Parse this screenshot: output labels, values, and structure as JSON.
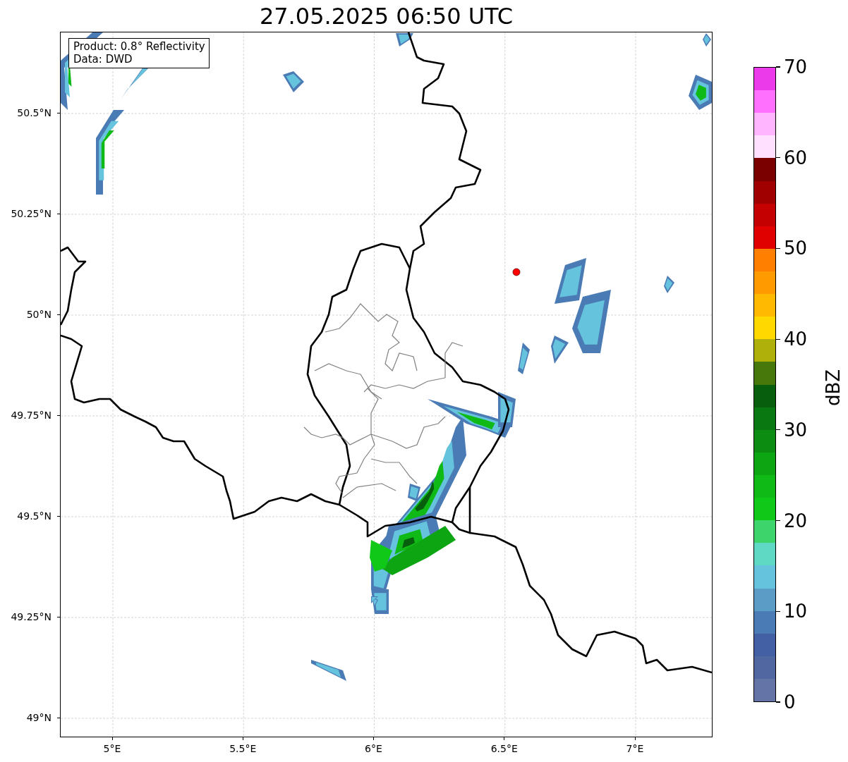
{
  "title": "27.05.2025 06:50 UTC",
  "legend": [
    "Product: 0.8° Reflectivity",
    "Data: DWD"
  ],
  "map": {
    "xticks": [
      "5°E",
      "5.5°E",
      "6°E",
      "6.5°E",
      "7°E"
    ],
    "yticks": [
      "50.5°N",
      "50.25°N",
      "50°N",
      "49.75°N",
      "49.5°N",
      "49.25°N",
      "49°N"
    ]
  },
  "colorbar": {
    "label": "dBZ",
    "ticks": [
      "70",
      "60",
      "50",
      "40",
      "30",
      "20",
      "10",
      "0"
    ],
    "bins": [
      {
        "color": "#ea3aea"
      },
      {
        "color": "#ff70ff"
      },
      {
        "color": "#ffb5ff"
      },
      {
        "color": "#ffe0ff"
      },
      {
        "color": "#7a0000"
      },
      {
        "color": "#a00000"
      },
      {
        "color": "#c40000"
      },
      {
        "color": "#e00000"
      },
      {
        "color": "#ff7f00"
      },
      {
        "color": "#ff9b00"
      },
      {
        "color": "#ffb900"
      },
      {
        "color": "#ffd800"
      },
      {
        "color": "#b0b00a"
      },
      {
        "color": "#46780c"
      },
      {
        "color": "#075e0c"
      },
      {
        "color": "#0a7810"
      },
      {
        "color": "#0c8d11"
      },
      {
        "color": "#0ea513"
      },
      {
        "color": "#0fba16"
      },
      {
        "color": "#10c818"
      },
      {
        "color": "#3dd46c"
      },
      {
        "color": "#5fd9c4"
      },
      {
        "color": "#66c3dd"
      },
      {
        "color": "#5a9cc6"
      },
      {
        "color": "#4a7bb5"
      },
      {
        "color": "#4360a4"
      },
      {
        "color": "#5067a1"
      },
      {
        "color": "#6474a6"
      }
    ]
  }
}
